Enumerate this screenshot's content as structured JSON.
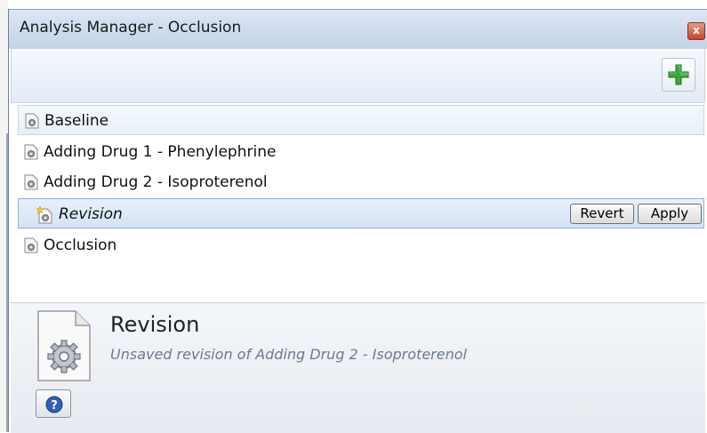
{
  "window": {
    "title": "Analysis Manager - Occlusion",
    "close_label": "x"
  },
  "toolbar": {
    "add_icon": "green-plus-icon"
  },
  "analyses": [
    {
      "label": "Baseline",
      "state": "highlighted"
    },
    {
      "label": "Adding Drug 1 - Phenylephrine",
      "state": "normal"
    },
    {
      "label": "Adding Drug 2 - Isoproterenol",
      "state": "normal"
    },
    {
      "label": "Revision",
      "state": "selected",
      "unsaved": true
    },
    {
      "label": "Occlusion",
      "state": "normal"
    }
  ],
  "revision_actions": {
    "revert_label": "Revert",
    "apply_label": "Apply"
  },
  "details": {
    "title": "Revision",
    "subtitle": "Unsaved revision of Adding Drug 2 - Isoproterenol",
    "icon": "gear-document-icon",
    "help_icon": "help-icon"
  },
  "colors": {
    "title_bar": "#cfdced",
    "selection": "#d4e3f5",
    "add_green": "#2f9e2f"
  }
}
